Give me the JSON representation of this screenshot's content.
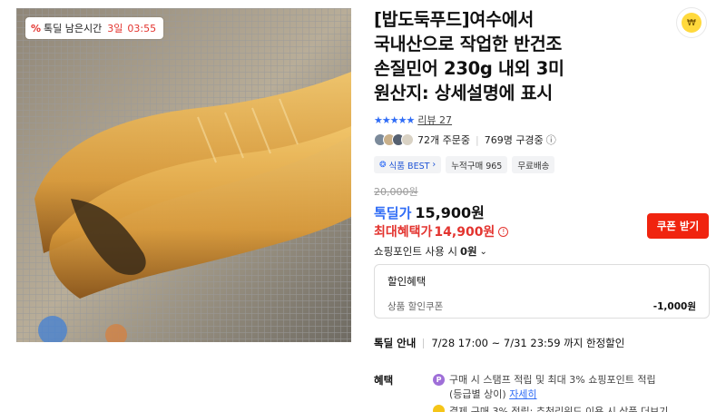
{
  "product": {
    "title_lines": [
      "[밥도둑푸드]여수에서",
      "국내산으로 작업한 반건조",
      "손질민어 230g 내외 3미",
      "원산지: 상세설명에 표시"
    ],
    "image_alt": "반건조 손질민어",
    "timer": {
      "badge": "%",
      "label": "톡딜 남은시간",
      "days": "3일",
      "time": "03:55"
    },
    "badge_text": "₩"
  },
  "rating": {
    "stars": "★★★★★",
    "review_label": "리뷰 27"
  },
  "buyers": {
    "orders": "72개 주문중",
    "subscribers": "769명 구경중",
    "info_icon": "ⓘ"
  },
  "chips": {
    "best_icon": "❂",
    "best": "식품 BEST",
    "best_chev": "›",
    "cumulative": "누적구매 965",
    "shipping": "무료배송"
  },
  "price": {
    "original": "20,000원",
    "deal_label": "톡딜가",
    "deal_price": "15,900원",
    "max_label": "최대혜택가",
    "max_price": "14,900원",
    "max_info": "!",
    "coupon_button": "쿠폰 받기"
  },
  "points": {
    "label": "쇼핑포인트 사용 시",
    "value": "0원",
    "chev": "⌄"
  },
  "discount": {
    "header": "할인혜택",
    "row_label": "상품 할인쿠폰",
    "row_value": "-1,000원"
  },
  "deal_info": {
    "label": "톡딜 안내",
    "value": "7/28 17:00 ~ 7/31 23:59 까지 한정할인"
  },
  "benefits": {
    "label": "혜택",
    "p_icon": "P",
    "line1": "구매 시 스탬프 적립 및 최대 3% 쇼핑포인트 적립",
    "line2_prefix": "(등급별 상이)",
    "line2_link": "자세히",
    "line3": "결제 구매 3% 적립: 추천리워드 이용 시 상품 더보기"
  },
  "colors": {
    "accent_blue": "#2f6cf6",
    "accent_red": "#e3342f",
    "coupon_red": "#f0240f"
  }
}
